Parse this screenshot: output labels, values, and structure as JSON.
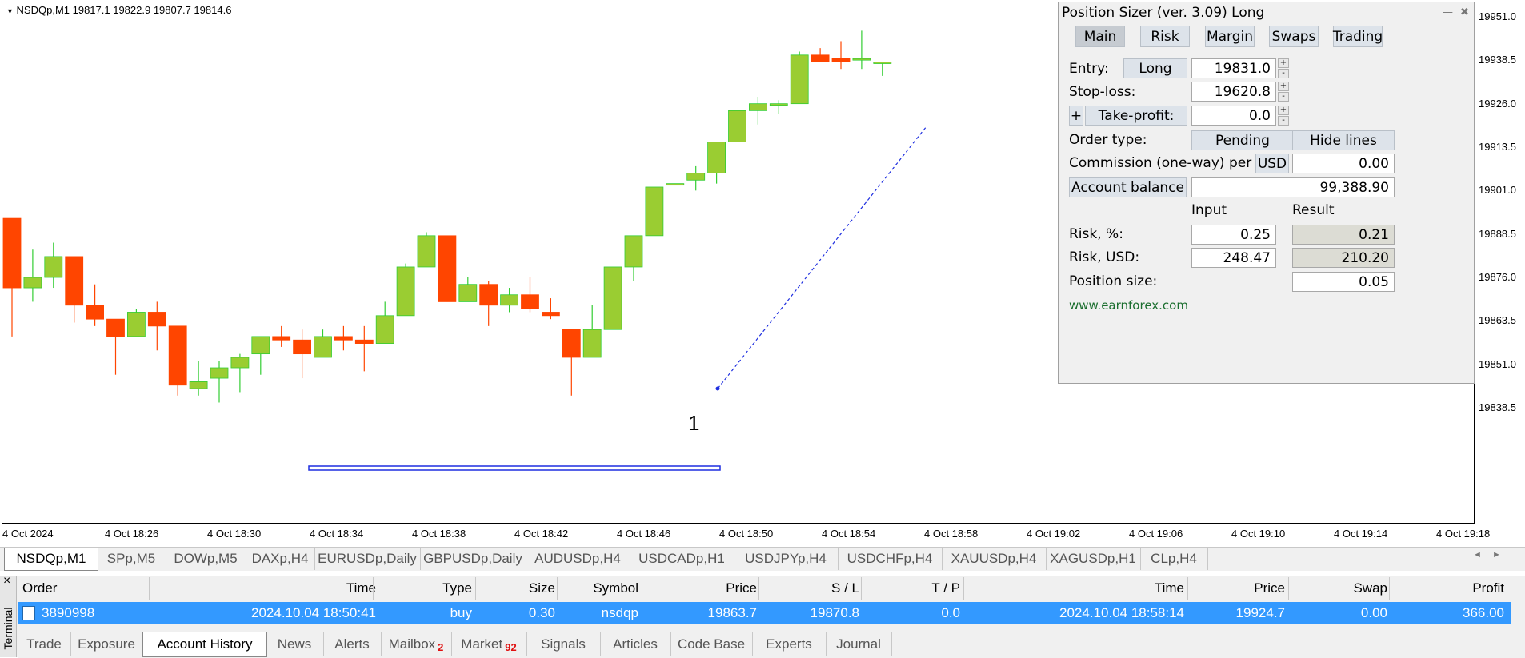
{
  "chart": {
    "symbol_info": "NSDQp,M1  19817.1 19822.9 19807.7 19814.6",
    "price_ticks": [
      "19951.0",
      "19938.5",
      "19926.0",
      "19913.5",
      "19901.0",
      "19888.5",
      "19876.0",
      "19863.5",
      "19851.0",
      "19838.5"
    ],
    "time_ticks": [
      "4 Oct 2024",
      "4 Oct 18:26",
      "4 Oct 18:30",
      "4 Oct 18:34",
      "4 Oct 18:38",
      "4 Oct 18:42",
      "4 Oct 18:46",
      "4 Oct 18:50",
      "4 Oct 18:54",
      "4 Oct 18:58",
      "4 Oct 19:02",
      "4 Oct 19:06",
      "4 Oct 19:10",
      "4 Oct 19:14",
      "4 Oct 19:18"
    ],
    "trade_marker": "1",
    "colors": {
      "bull": "#9acd32",
      "bear": "#ff4500",
      "bull_wick": "#32cd32",
      "bear_wick": "#ff4500"
    },
    "candles": [
      {
        "o": 19893,
        "h": 19893,
        "l": 19859,
        "c": 19873
      },
      {
        "o": 19873,
        "h": 19884,
        "l": 19869,
        "c": 19876
      },
      {
        "o": 19876,
        "h": 19886,
        "l": 19873,
        "c": 19882
      },
      {
        "o": 19882,
        "h": 19882,
        "l": 19863,
        "c": 19868
      },
      {
        "o": 19868,
        "h": 19874,
        "l": 19862,
        "c": 19864
      },
      {
        "o": 19864,
        "h": 19864,
        "l": 19848,
        "c": 19859
      },
      {
        "o": 19859,
        "h": 19867,
        "l": 19859,
        "c": 19866
      },
      {
        "o": 19866,
        "h": 19869,
        "l": 19855,
        "c": 19862
      },
      {
        "o": 19862,
        "h": 19862,
        "l": 19842,
        "c": 19845
      },
      {
        "o": 19844,
        "h": 19852,
        "l": 19842,
        "c": 19846
      },
      {
        "o": 19847,
        "h": 19852,
        "l": 19840,
        "c": 19850
      },
      {
        "o": 19850,
        "h": 19854,
        "l": 19843,
        "c": 19853
      },
      {
        "o": 19854,
        "h": 19859,
        "l": 19848,
        "c": 19859
      },
      {
        "o": 19859,
        "h": 19862,
        "l": 19856,
        "c": 19858
      },
      {
        "o": 19858,
        "h": 19861,
        "l": 19847,
        "c": 19854
      },
      {
        "o": 19853,
        "h": 19861,
        "l": 19853,
        "c": 19859
      },
      {
        "o": 19859,
        "h": 19862,
        "l": 19855,
        "c": 19858
      },
      {
        "o": 19858,
        "h": 19862,
        "l": 19849,
        "c": 19857
      },
      {
        "o": 19857,
        "h": 19869,
        "l": 19857,
        "c": 19865
      },
      {
        "o": 19865,
        "h": 19880,
        "l": 19865,
        "c": 19879
      },
      {
        "o": 19879,
        "h": 19889,
        "l": 19879,
        "c": 19888
      },
      {
        "o": 19888,
        "h": 19888,
        "l": 19869,
        "c": 19869
      },
      {
        "o": 19869,
        "h": 19876,
        "l": 19870,
        "c": 19874
      },
      {
        "o": 19874,
        "h": 19875,
        "l": 19862,
        "c": 19868
      },
      {
        "o": 19868,
        "h": 19873,
        "l": 19866,
        "c": 19871
      },
      {
        "o": 19871,
        "h": 19876,
        "l": 19866,
        "c": 19867
      },
      {
        "o": 19866,
        "h": 19870,
        "l": 19864,
        "c": 19865
      },
      {
        "o": 19861,
        "h": 19861,
        "l": 19842,
        "c": 19853
      },
      {
        "o": 19853,
        "h": 19868,
        "l": 19853,
        "c": 19861
      },
      {
        "o": 19861,
        "h": 19879,
        "l": 19861,
        "c": 19879
      },
      {
        "o": 19879,
        "h": 19888,
        "l": 19875,
        "c": 19888
      },
      {
        "o": 19888,
        "h": 19902,
        "l": 19888,
        "c": 19902
      },
      {
        "o": 19903,
        "h": 19903,
        "l": 19903,
        "c": 19903
      },
      {
        "o": 19904,
        "h": 19908,
        "l": 19901,
        "c": 19906
      },
      {
        "o": 19906,
        "h": 19913,
        "l": 19903,
        "c": 19915
      },
      {
        "o": 19915,
        "h": 19924,
        "l": 19915,
        "c": 19924
      },
      {
        "o": 19924,
        "h": 19928,
        "l": 19920,
        "c": 19926
      },
      {
        "o": 19926,
        "h": 19927,
        "l": 19923,
        "c": 19926
      },
      {
        "o": 19926,
        "h": 19941,
        "l": 19926,
        "c": 19940
      },
      {
        "o": 19940,
        "h": 19942,
        "l": 19938,
        "c": 19938
      },
      {
        "o": 19939,
        "h": 19944,
        "l": 19936,
        "c": 19938
      },
      {
        "o": 19939,
        "h": 19947,
        "l": 19936,
        "c": 19939
      },
      {
        "o": 19938,
        "h": 19938,
        "l": 19934,
        "c": 19938
      }
    ]
  },
  "position_sizer": {
    "title": "Position Sizer (ver. 3.09) Long",
    "minimize": "—",
    "close": "✖",
    "tabs": [
      "Main",
      "Risk",
      "Margin",
      "Swaps",
      "Trading"
    ],
    "entry_label": "Entry:",
    "entry_button": "Long",
    "entry_value": "19831.0",
    "stop_label": "Stop-loss:",
    "stop_value": "19620.8",
    "tp_plus": "+",
    "tp_label": "Take-profit:",
    "tp_value": "0.0",
    "order_type_label": "Order type:",
    "order_type_button": "Pending",
    "hide_lines_button": "Hide lines",
    "commission_label": "Commission (one-way) per lot:",
    "commission_currency": "USD",
    "commission_value": "0.00",
    "account_balance_button": "Account balance",
    "account_balance_value": "99,388.90",
    "input_header": "Input",
    "result_header": "Result",
    "risk_pct_label": "Risk, %:",
    "risk_pct_input": "0.25",
    "risk_pct_result": "0.21",
    "risk_usd_label": "Risk, USD:",
    "risk_usd_input": "248.47",
    "risk_usd_result": "210.20",
    "position_size_label": "Position size:",
    "position_size_value": "0.05",
    "website": "www.earnforex.com",
    "spin_up": "+",
    "spin_down": "-"
  },
  "chart_tabs": [
    "NSDQp,M1",
    "SPp,M5",
    "DOWp,M5",
    "DAXp,H4",
    "EURUSDp,Daily",
    "GBPUSDp,Daily",
    "AUDUSDp,H4",
    "USDCADp,H1",
    "USDJPYp,H4",
    "USDCHFp,H4",
    "XAUUSDp,H4",
    "XAGUSDp,H1",
    "CLp,H4"
  ],
  "tab_scroll": {
    "left": "◄",
    "right": "►"
  },
  "terminal": {
    "side_label": "Terminal",
    "close": "×",
    "columns": [
      "Order",
      "Time",
      "Type",
      "Size",
      "Symbol",
      "Price",
      "S / L",
      "T / P",
      "Time",
      "Price",
      "Swap",
      "Profit"
    ],
    "row": [
      "3890998",
      "2024.10.04 18:50:41",
      "buy",
      "0.30",
      "nsdqp",
      "19863.7",
      "19870.8",
      "0.0",
      "2024.10.04 18:58:14",
      "19924.7",
      "0.00",
      "366.00"
    ],
    "tabs": [
      {
        "label": "Trade",
        "badge": ""
      },
      {
        "label": "Exposure",
        "badge": ""
      },
      {
        "label": "Account History",
        "badge": ""
      },
      {
        "label": "News",
        "badge": ""
      },
      {
        "label": "Alerts",
        "badge": ""
      },
      {
        "label": "Mailbox",
        "badge": "2"
      },
      {
        "label": "Market",
        "badge": "92"
      },
      {
        "label": "Signals",
        "badge": ""
      },
      {
        "label": "Articles",
        "badge": ""
      },
      {
        "label": "Code Base",
        "badge": ""
      },
      {
        "label": "Experts",
        "badge": ""
      },
      {
        "label": "Journal",
        "badge": ""
      }
    ]
  }
}
